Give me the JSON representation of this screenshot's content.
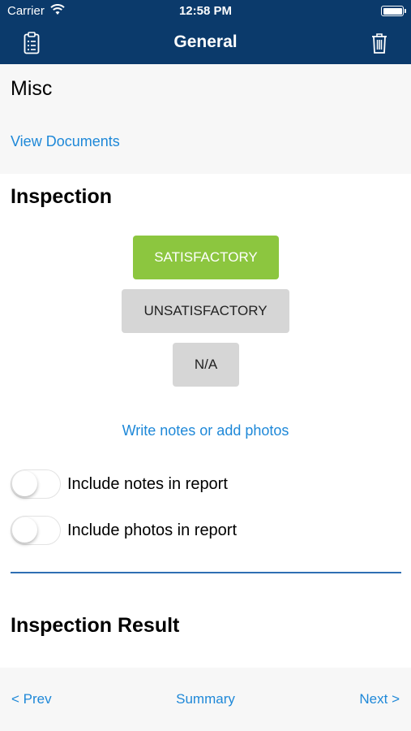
{
  "status_bar": {
    "carrier": "Carrier",
    "time": "12:58 PM"
  },
  "nav": {
    "title": "General",
    "left_icon": "clipboard-list-icon",
    "right_icon": "trash-icon"
  },
  "misc": {
    "title": "Misc",
    "view_documents": "View Documents"
  },
  "inspection": {
    "title": "Inspection",
    "options": [
      {
        "label": "SATISFACTORY",
        "selected": true
      },
      {
        "label": "UNSATISFACTORY",
        "selected": false
      },
      {
        "label": "N/A",
        "selected": false
      }
    ],
    "notes_link": "Write notes or add photos",
    "toggles": [
      {
        "label": "Include notes in report",
        "on": false
      },
      {
        "label": "Include photos in report",
        "on": false
      }
    ]
  },
  "result": {
    "title": "Inspection Result"
  },
  "footer": {
    "prev": "< Prev",
    "summary": "Summary",
    "next": "Next >"
  },
  "colors": {
    "nav_bg": "#0b3a6b",
    "selected": "#8cc63f",
    "unselected": "#d6d6d6",
    "link": "#1e88d8",
    "divider": "#2f6fb3"
  }
}
